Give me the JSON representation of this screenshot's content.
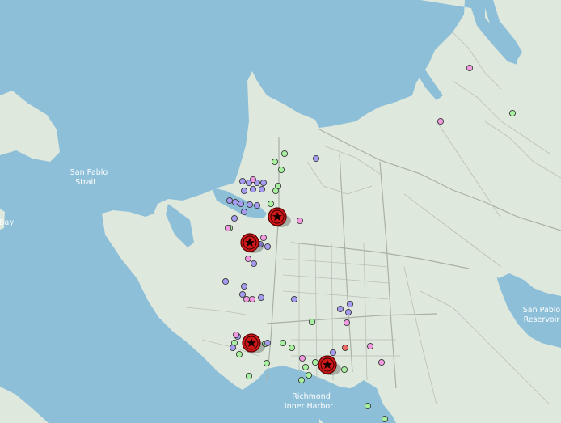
{
  "map": {
    "labels": {
      "strait_line1": "San Pablo",
      "strait_line2": "Strait",
      "bay_fragment": "Bay",
      "reservoir_line1": "San Pablo",
      "reservoir_line2": "Reservoir",
      "harbor_line1": "Richmond",
      "harbor_line2": "Inner Harbor"
    },
    "colors": {
      "water": "#8ebfd9",
      "land": "#dfe8dc",
      "road": "#b9bfb6",
      "marker_green": "#a6f0a0",
      "marker_purple": "#a59cf2",
      "marker_pink": "#f19ae0",
      "marker_red": "#ee6a62",
      "star_marker": "#d01818"
    },
    "point_icon_names": [
      "green-circle-marker",
      "purple-circle-marker",
      "pink-circle-marker",
      "red-circle-marker"
    ],
    "star_icon_name": "red-star-marker"
  }
}
